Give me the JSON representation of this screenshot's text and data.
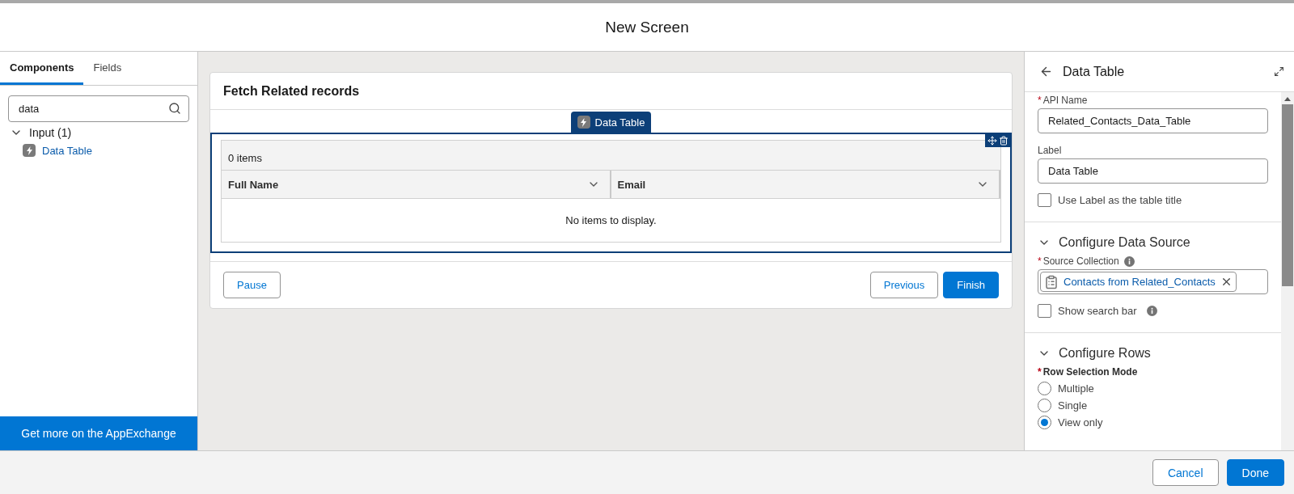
{
  "window": {
    "title": "New Screen"
  },
  "left_panel": {
    "tabs": [
      {
        "label": "Components",
        "selected": true
      },
      {
        "label": "Fields",
        "selected": false
      }
    ],
    "search": {
      "value": "data"
    },
    "groups": [
      {
        "label": "Input (1)",
        "expanded": true,
        "children": [
          {
            "label": "Data Table"
          }
        ]
      }
    ],
    "footer_link": "Get more on the AppExchange"
  },
  "screen": {
    "title": "Fetch Related records",
    "component": {
      "tag": "Data Table",
      "selected": true,
      "count": "0 items",
      "columns": [
        "Full Name",
        "Email"
      ],
      "empty_message": "No items to display."
    },
    "buttons": [
      {
        "label": "Pause",
        "kind": "neutral"
      },
      {
        "label": "Previous",
        "kind": "neutral"
      },
      {
        "label": "Finish",
        "kind": "brand"
      }
    ]
  },
  "properties": {
    "title": "Data Table",
    "items": [
      {
        "kind": "field",
        "label": "API Name",
        "required_mark": "*",
        "value": "Related_Contacts_Data_Table"
      },
      {
        "kind": "field",
        "label": "Label",
        "value": "Data Table"
      },
      {
        "kind": "checkbox",
        "label": "Use Label as the table title",
        "checked": false,
        "info": false
      },
      {
        "kind": "section",
        "title": "Configure Data Source",
        "expanded": true
      },
      {
        "kind": "pill_field",
        "label": "Source Collection",
        "required_mark": "*",
        "info": true,
        "value": "Contacts from Related_Contacts"
      },
      {
        "kind": "checkbox",
        "label": "Show search bar",
        "checked": false,
        "info": true
      },
      {
        "kind": "section",
        "title": "Configure Rows",
        "expanded": true
      },
      {
        "kind": "radio_group",
        "label": "Row Selection Mode",
        "required_mark": "*",
        "options": [
          {
            "label": "Multiple",
            "selected": false
          },
          {
            "label": "Single",
            "selected": false
          },
          {
            "label": "View only",
            "selected": true
          }
        ]
      }
    ]
  },
  "footer_buttons": [
    {
      "label": "Cancel",
      "kind": "neutral"
    },
    {
      "label": "Done",
      "kind": "brand"
    }
  ]
}
